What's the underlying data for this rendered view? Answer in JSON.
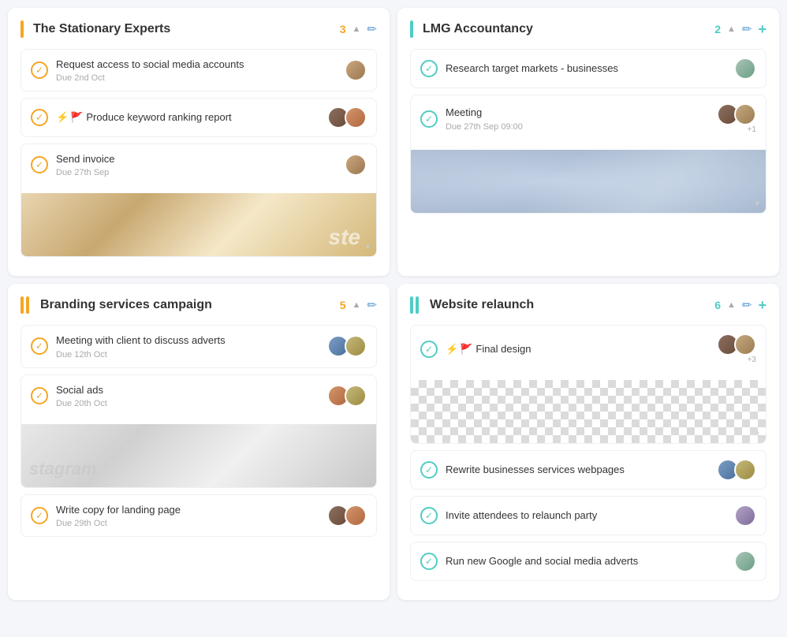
{
  "columns": [
    {
      "id": "stationary-experts",
      "title": "The Stationary Experts",
      "count": "3",
      "countColor": "orange",
      "barType": "single",
      "barColor": "orange",
      "tasks": [
        {
          "id": "task-1",
          "title": "Request access to social media accounts",
          "due": "Due 2nd Oct",
          "flags": [],
          "avatars": [
            "av1"
          ],
          "hasImage": false
        },
        {
          "id": "task-2",
          "title": "Produce keyword ranking report",
          "due": "",
          "flags": [
            "red",
            "orange"
          ],
          "avatars": [
            "av2",
            "av3"
          ],
          "hasImage": false
        },
        {
          "id": "task-3",
          "title": "Send invoice",
          "due": "Due 27th Sep",
          "flags": [],
          "avatars": [
            "av1"
          ],
          "hasImage": true,
          "imageType": "stationery"
        }
      ]
    },
    {
      "id": "lmg-accountancy",
      "title": "LMG Accountancy",
      "count": "2",
      "countColor": "teal",
      "barType": "single",
      "barColor": "teal",
      "tasks": [
        {
          "id": "task-4",
          "title": "Research target markets - businesses",
          "due": "",
          "flags": [],
          "avatars": [
            "av4"
          ],
          "hasImage": false
        },
        {
          "id": "task-5",
          "title": "Meeting",
          "due": "Due 27th Sep 09:00",
          "flags": [],
          "avatars": [
            "av2",
            "av5"
          ],
          "avatarCount": "+1",
          "hasImage": true,
          "imageType": "meeting"
        }
      ]
    },
    {
      "id": "branding-campaign",
      "title": "Branding services campaign",
      "count": "5",
      "countColor": "orange",
      "barType": "double",
      "barColor": "orange",
      "tasks": [
        {
          "id": "task-6",
          "title": "Meeting with client to discuss adverts",
          "due": "Due 12th Oct",
          "flags": [],
          "avatars": [
            "av6",
            "av7"
          ],
          "hasImage": false
        },
        {
          "id": "task-7",
          "title": "Social ads",
          "due": "Due 20th Oct",
          "flags": [],
          "avatars": [
            "av3",
            "av7"
          ],
          "hasImage": true,
          "imageType": "instagram"
        },
        {
          "id": "task-8",
          "title": "Write copy for landing page",
          "due": "Due 29th Oct",
          "flags": [],
          "avatars": [
            "av2",
            "av3"
          ],
          "hasImage": false
        }
      ]
    },
    {
      "id": "website-relaunch",
      "title": "Website relaunch",
      "count": "6",
      "countColor": "teal",
      "barType": "double",
      "barColor": "teal",
      "tasks": [
        {
          "id": "task-9",
          "title": "Final design",
          "due": "",
          "flags": [
            "red",
            "orange"
          ],
          "avatars": [
            "av2",
            "av5"
          ],
          "avatarCount": "+3",
          "hasImage": true,
          "imageType": "checkered"
        },
        {
          "id": "task-10",
          "title": "Rewrite businesses services webpages",
          "due": "",
          "flags": [],
          "avatars": [
            "av6",
            "av7"
          ],
          "hasImage": false
        },
        {
          "id": "task-11",
          "title": "Invite attendees to relaunch party",
          "due": "",
          "flags": [],
          "avatars": [
            "av8"
          ],
          "hasImage": false
        },
        {
          "id": "task-12",
          "title": "Run new Google and social media adverts",
          "due": "",
          "flags": [],
          "avatars": [
            "av4"
          ],
          "hasImage": false
        }
      ]
    }
  ],
  "icons": {
    "check": "✓",
    "flag_red": "🚩",
    "bolt": "⚡",
    "chevron_up": "▲",
    "edit": "✏",
    "add": "+",
    "scroll_down": "▾"
  }
}
